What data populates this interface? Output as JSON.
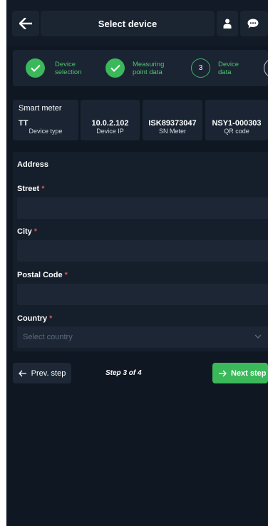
{
  "header": {
    "title": "Select device"
  },
  "stepper": {
    "steps": [
      {
        "label_line1": "Device",
        "label_line2": "selection",
        "state": "done"
      },
      {
        "label_line1": "Measuring",
        "label_line2": "point data",
        "state": "done"
      },
      {
        "number": "3",
        "label_line1": "Device",
        "label_line2": "data",
        "state": "current"
      }
    ]
  },
  "device_info": {
    "type_value": "Smart meter",
    "type_code": "TT",
    "type_label": "Device type",
    "ip_value": "10.0.2.102",
    "ip_label": "Device IP",
    "sn_value": "ISK89373047",
    "sn_label": "SN Meter",
    "qr_value": "NSY1-000303",
    "qr_label": "QR code"
  },
  "form": {
    "section_title": "Address",
    "street_label": "Street",
    "city_label": "City",
    "postal_label": "Postal Code",
    "country_label": "Country",
    "required_mark": "*",
    "street_value": "",
    "city_value": "",
    "postal_value": "",
    "country_placeholder": "Select country"
  },
  "footer": {
    "prev_label": "Prev. step",
    "step_indicator": "Step 3 of 4",
    "next_label": "Next step"
  },
  "colors": {
    "accent": "#3bb85a",
    "background": "#0f1722",
    "required": "#e84c4c"
  }
}
